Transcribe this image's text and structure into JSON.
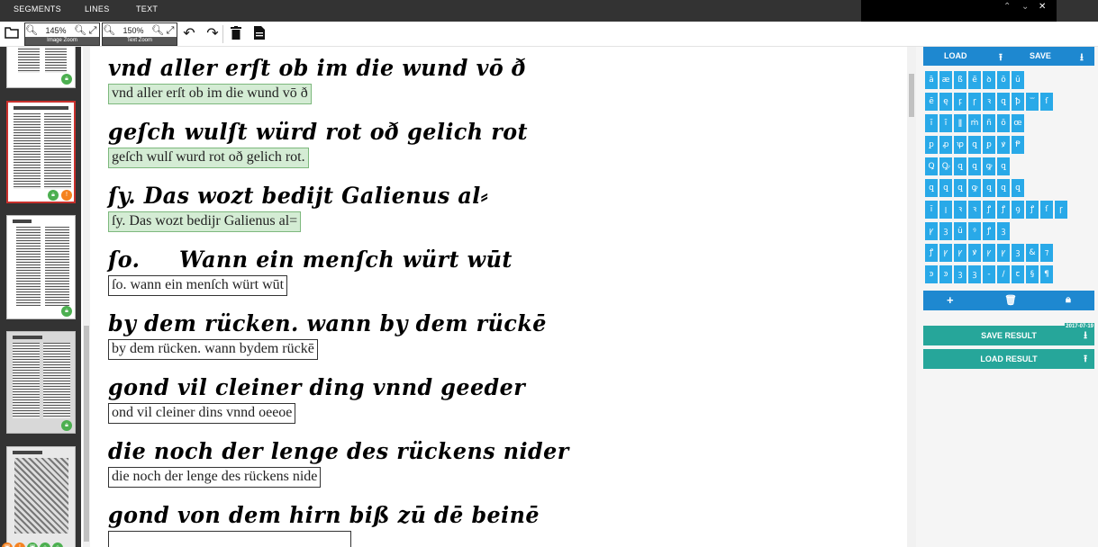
{
  "tabs": [
    "SEGMENTS",
    "LINES",
    "TEXT"
  ],
  "window_controls": [
    "⌃",
    "⌄",
    "✕"
  ],
  "toolbar": {
    "image_zoom": {
      "value": "145%",
      "label": "Image Zoom"
    },
    "text_zoom": {
      "value": "150%",
      "label": "Text Zoom"
    }
  },
  "lines": [
    {
      "manuscript": "vnd aller erſt ob im die wund vō ð",
      "transcription": "vnd aller erſt ob im die wund vō ð",
      "status": "correct"
    },
    {
      "manuscript": "geſch wulſt würd rot oð gelich rot",
      "transcription": "geſch wulſ wurd rot oð gelich rot.",
      "status": "correct"
    },
    {
      "manuscript": "ſy. Das wozt bedijt Galienus al⸗",
      "transcription": "ſy. Das wozt bedijr Galienus al=",
      "status": "correct"
    },
    {
      "manuscript": "ſo.     Wann ein menſch würt wūt",
      "transcription": "ſo. wann ein menſch würt wūt",
      "status": "pending"
    },
    {
      "manuscript": "by dem rücken. wann by dem rückē",
      "transcription": "by dem rücken. wann bydem rückē",
      "status": "pending"
    },
    {
      "manuscript": "gond vil cleiner ding vnnd geeder",
      "transcription": "ond vil cleiner dins vnnd oeeoe",
      "status": "pending"
    },
    {
      "manuscript": "die noch der lenge des rückens nider",
      "transcription": "die noch der lenge des rückens nide",
      "status": "pending"
    },
    {
      "manuscript": "gond von dem hirn biß zū dē beinē",
      "transcription": "",
      "status": "pending"
    }
  ],
  "panel": {
    "load_label": "LOAD",
    "save_label": "SAVE",
    "keyboard_rows": [
      [
        "ā",
        "æ",
        "ß",
        "ẽ",
        "ꝺ",
        "ō",
        "ū"
      ],
      [
        "ē",
        "ę",
        "ꝼ",
        "ꞅ",
        "ꝛ",
        "ꝗ",
        "ꝥ",
        "ᷓ",
        "ſ"
      ],
      [
        "ī",
        "ȋ",
        "ǁ",
        "ṁ",
        "ñ",
        "ō",
        "œ"
      ],
      [
        "ꝑ",
        "ꝓ",
        "ꝕ",
        "ꝗ",
        "ꝑ",
        "ꝟ",
        "Ᵽ"
      ],
      [
        "Ꝗ",
        "Ꝙ",
        "ꝗ",
        "ꝗ",
        "ꝙ",
        "ꝗ"
      ],
      [
        "ꝗ",
        "ꝗ",
        "ꝗ",
        "ꝙ",
        "ꝗ",
        "ꝗ",
        "ꝗ"
      ],
      [
        "ī",
        "ꞁ",
        "ꝛ",
        "ꝛ",
        "ꝭ",
        "ꝭ",
        "ꝯ",
        "ꝭ",
        "ſ",
        "ꞅ"
      ],
      [
        "ꝩ",
        "ꝫ",
        "ū",
        "ꝰ",
        "ꝭ",
        "ꝫ"
      ],
      [
        "ꝭ",
        "ꝩ",
        "ꝩ",
        "ꝟ",
        "ꝩ",
        "ꝩ",
        "ꝫ",
        "&",
        "⁊"
      ],
      [
        "ꜿ",
        "ꜿ",
        "ꝫ",
        "ꝫ",
        "-",
        "/",
        "ꞇ",
        "§",
        "¶"
      ]
    ],
    "add_symbol": "+",
    "save_result_label": "SAVE RESULT",
    "save_result_date": "2017-07-19",
    "load_result_label": "LOAD RESULT"
  },
  "colors": {
    "accent_blue": "#1e88d0",
    "key_blue": "#29a9e8",
    "teal": "#26a69a",
    "correct_green": "#d4ecd4"
  }
}
